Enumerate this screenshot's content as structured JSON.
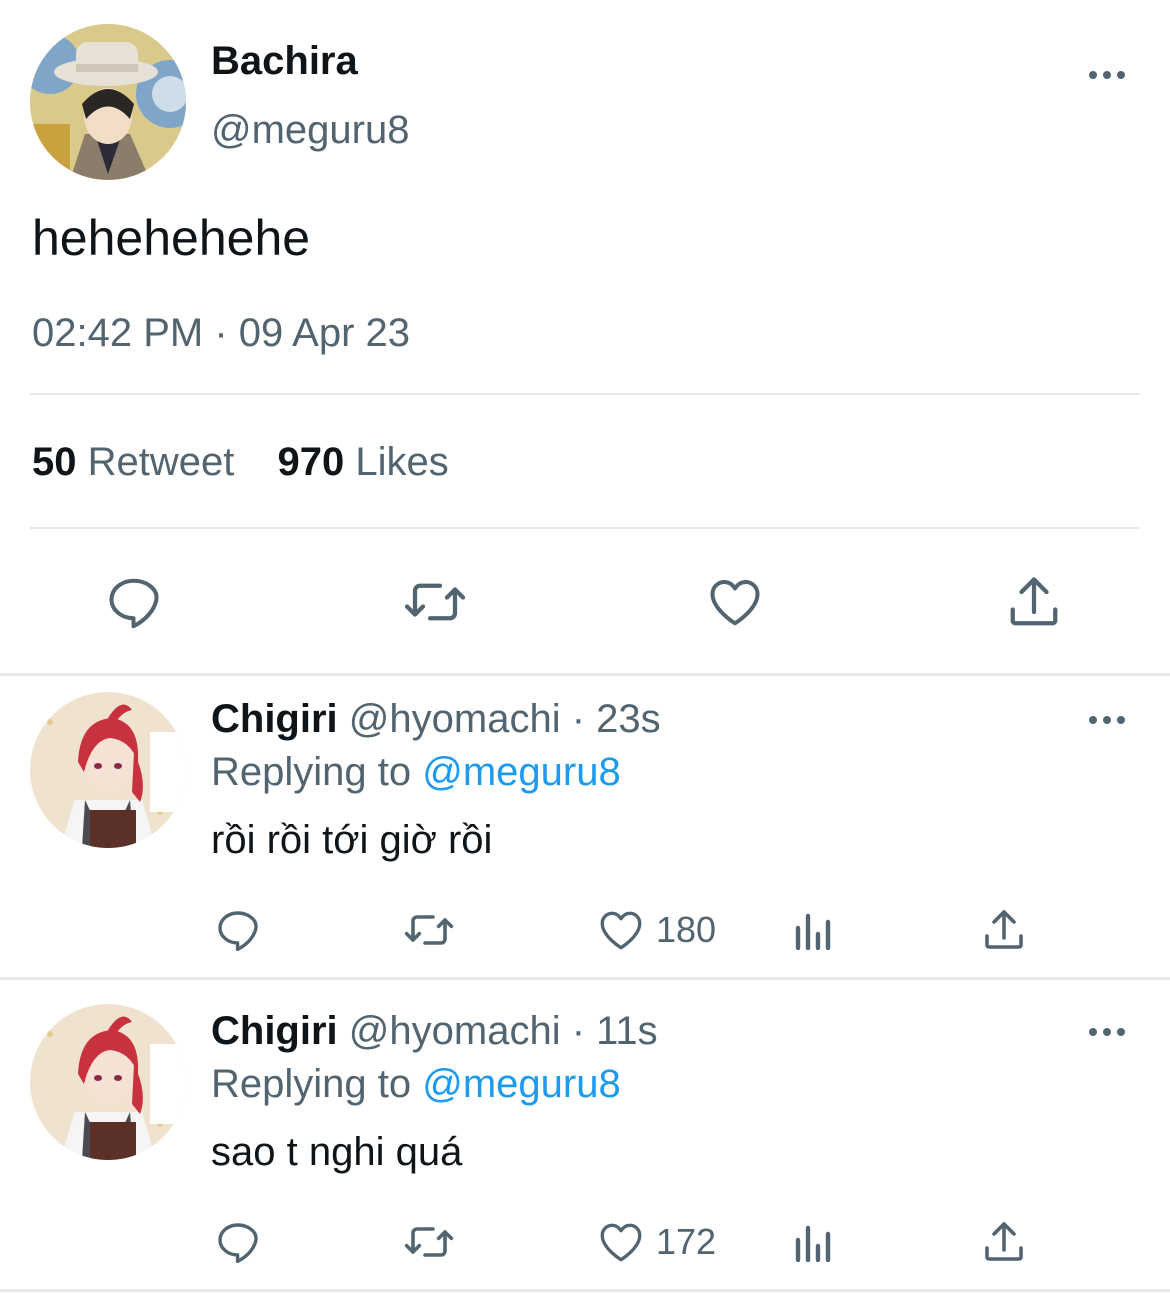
{
  "main_tweet": {
    "display_name": "Bachira",
    "handle": "@meguru8",
    "text": "hehehehehe",
    "timestamp": "02:42 PM · 09 Apr 23",
    "retweet_count": "50",
    "retweet_label": "Retweet",
    "likes_count": "970",
    "likes_label": "Likes"
  },
  "replies": [
    {
      "display_name": "Chigiri",
      "handle": "@hyomachi",
      "time": "· 23s",
      "replying_label": "Replying to",
      "replying_handle": "@meguru8",
      "text": "rồi rồi tới giờ rồi",
      "like_count": "180"
    },
    {
      "display_name": "Chigiri",
      "handle": "@hyomachi",
      "time": "· 11s",
      "replying_label": "Replying to",
      "replying_handle": "@meguru8",
      "text": "sao t nghi quá",
      "like_count": "172"
    }
  ],
  "colors": {
    "accent": "#1d9bf0",
    "secondary_text": "#536471",
    "divider": "#e6e9eb"
  },
  "icons": [
    "more-icon",
    "reply-icon",
    "retweet-icon",
    "like-icon",
    "share-icon",
    "analytics-icon"
  ]
}
